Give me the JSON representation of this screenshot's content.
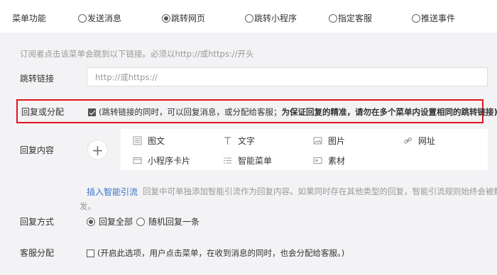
{
  "menu_function": {
    "label": "菜单功能",
    "options": [
      {
        "label": "发送消息",
        "selected": false
      },
      {
        "label": "跳转网页",
        "selected": true
      },
      {
        "label": "跳转小程序",
        "selected": false
      },
      {
        "label": "指定客服",
        "selected": false
      },
      {
        "label": "推送事件",
        "selected": false
      }
    ]
  },
  "hint": "订阅者点击该菜单会跳到以下链接。必须以http://或https://开头",
  "jump_link": {
    "label": "跳转链接",
    "placeholder": "http://或https://",
    "value": ""
  },
  "reply_or_assign": {
    "label": "回复或分配",
    "checked": true,
    "text_normal": "(跳转链接的同时，可以回复消息，或分配给客服；",
    "text_bold": "为保证回复的精准，请勿在多个菜单内设置相同的跳转链接)"
  },
  "reply_content": {
    "label": "回复内容",
    "add_symbol": "+",
    "types": [
      {
        "label": "图文",
        "icon": "article-icon"
      },
      {
        "label": "文字",
        "icon": "text-icon"
      },
      {
        "label": "图片",
        "icon": "image-icon"
      },
      {
        "label": "网址",
        "icon": "link-icon"
      },
      {
        "label": "小程序卡片",
        "icon": "miniprogram-card-icon"
      },
      {
        "label": "智能菜单",
        "icon": "smart-menu-icon"
      },
      {
        "label": "素材",
        "icon": "material-icon"
      }
    ]
  },
  "smart_guide": {
    "link": "插入智能引流",
    "desc_line1": "回复中可单独添加智能引流作为回复内容。如果同时存在其他类型的回复，智能引流规则始终会被触",
    "desc_line2": "发。"
  },
  "reply_mode": {
    "label": "回复方式",
    "options": [
      {
        "label": "回复全部",
        "selected": true
      },
      {
        "label": "随机回复一条",
        "selected": false
      }
    ]
  },
  "customer_service": {
    "label": "客服分配",
    "checked": false,
    "text": "(开启此选项，用户点击菜单，在收到消息的同时，也会分配给客服。)"
  },
  "colors": {
    "highlight_border": "#e0141e",
    "link": "#3a73c9",
    "panel_bg": "#f3f3f5"
  }
}
